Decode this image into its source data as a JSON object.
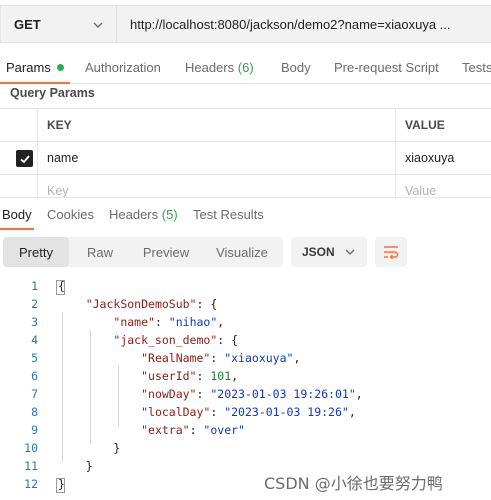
{
  "request": {
    "method": "GET",
    "url": "http://localhost:8080/jackson/demo2?name=xiaoxuya ..."
  },
  "request_tabs": [
    {
      "label": "Params",
      "active": true
    },
    {
      "label": "Authorization"
    },
    {
      "label": "Headers",
      "count": "(6)"
    },
    {
      "label": "Body"
    },
    {
      "label": "Pre-request Script"
    },
    {
      "label": "Tests"
    }
  ],
  "query_params": {
    "title": "Query Params",
    "headers": {
      "key": "KEY",
      "value": "VALUE"
    },
    "rows": [
      {
        "key": "name",
        "value": "xiaoxuya",
        "checked": true
      }
    ],
    "placeholder": {
      "key": "Key",
      "value": "Value"
    }
  },
  "response_tabs": [
    {
      "label": "Body",
      "active": true
    },
    {
      "label": "Cookies"
    },
    {
      "label": "Headers",
      "count": "(5)"
    },
    {
      "label": "Test Results"
    }
  ],
  "view_modes": [
    "Pretty",
    "Raw",
    "Preview",
    "Visualize"
  ],
  "active_view": "Pretty",
  "format": "JSON",
  "code_lines": [
    [
      {
        "t": "p",
        "v": "{"
      }
    ],
    [
      {
        "t": "p",
        "v": "    "
      },
      {
        "t": "k",
        "v": "\"JackSonDemoSub\""
      },
      {
        "t": "p",
        "v": ": {"
      }
    ],
    [
      {
        "t": "p",
        "v": "        "
      },
      {
        "t": "k",
        "v": "\"name\""
      },
      {
        "t": "p",
        "v": ": "
      },
      {
        "t": "s",
        "v": "\"nihao\""
      },
      {
        "t": "p",
        "v": ","
      }
    ],
    [
      {
        "t": "p",
        "v": "        "
      },
      {
        "t": "k",
        "v": "\"jack_son_demo\""
      },
      {
        "t": "p",
        "v": ": {"
      }
    ],
    [
      {
        "t": "p",
        "v": "            "
      },
      {
        "t": "k",
        "v": "\"RealName\""
      },
      {
        "t": "p",
        "v": ": "
      },
      {
        "t": "s",
        "v": "\"xiaoxuya\""
      },
      {
        "t": "p",
        "v": ","
      }
    ],
    [
      {
        "t": "p",
        "v": "            "
      },
      {
        "t": "k",
        "v": "\"userId\""
      },
      {
        "t": "p",
        "v": ": "
      },
      {
        "t": "n",
        "v": "101"
      },
      {
        "t": "p",
        "v": ","
      }
    ],
    [
      {
        "t": "p",
        "v": "            "
      },
      {
        "t": "k",
        "v": "\"nowDay\""
      },
      {
        "t": "p",
        "v": ": "
      },
      {
        "t": "s",
        "v": "\"2023-01-03 19:26:01\""
      },
      {
        "t": "p",
        "v": ","
      }
    ],
    [
      {
        "t": "p",
        "v": "            "
      },
      {
        "t": "k",
        "v": "\"localDay\""
      },
      {
        "t": "p",
        "v": ": "
      },
      {
        "t": "s",
        "v": "\"2023-01-03 19:26\""
      },
      {
        "t": "p",
        "v": ","
      }
    ],
    [
      {
        "t": "p",
        "v": "            "
      },
      {
        "t": "k",
        "v": "\"extra\""
      },
      {
        "t": "p",
        "v": ": "
      },
      {
        "t": "s",
        "v": "\"over\""
      }
    ],
    [
      {
        "t": "p",
        "v": "        }"
      }
    ],
    [
      {
        "t": "p",
        "v": "    }"
      }
    ],
    [
      {
        "t": "p",
        "v": "}"
      }
    ]
  ],
  "line_numbers": [
    "1",
    "2",
    "3",
    "4",
    "5",
    "6",
    "7",
    "8",
    "9",
    "10",
    "11",
    "12"
  ],
  "watermark": "CSDN @小徐也要努力鸭",
  "colors": {
    "accent": "#ff6c37",
    "key": "#8a1e13",
    "string": "#0b3bbd",
    "number": "#1c7a35",
    "line_number": "#2d73c0",
    "status_dot": "#26b34a"
  }
}
